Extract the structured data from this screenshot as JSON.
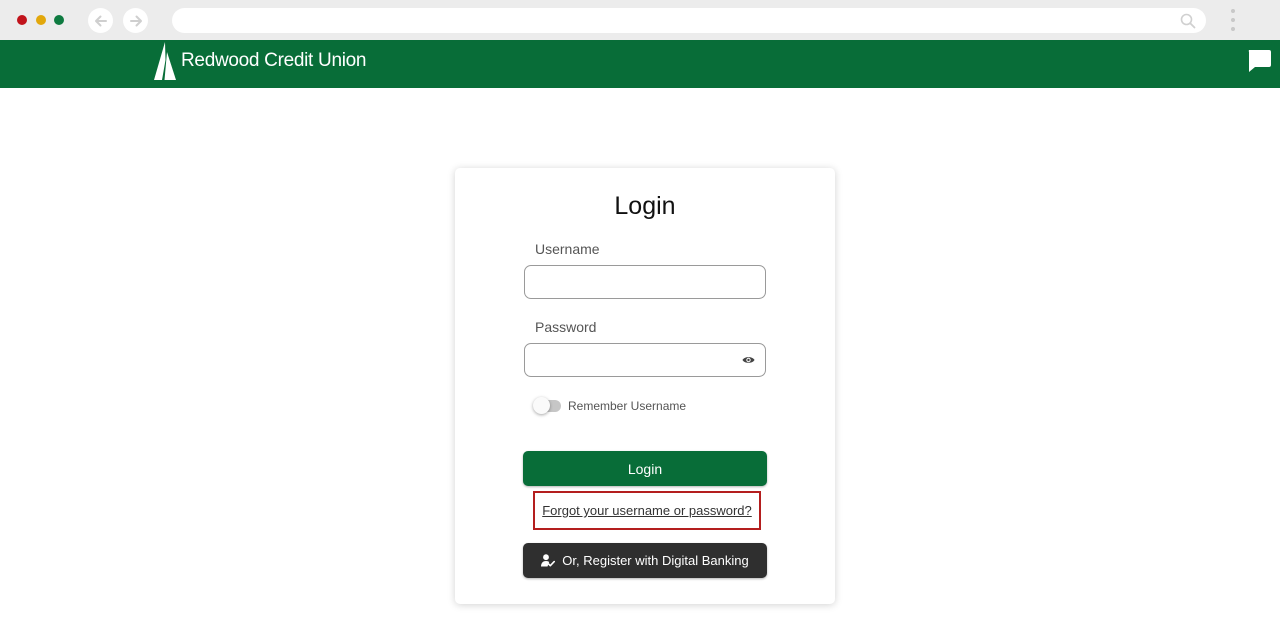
{
  "colors": {
    "brand_green": "#086d38",
    "dark_button": "#2f2f2f",
    "highlight_red": "#b41e1e",
    "traffic_red": "#c1131b",
    "traffic_yellow": "#e2a70b",
    "traffic_green": "#0e7a40"
  },
  "browser": {
    "back_icon": "arrow-left-icon",
    "forward_icon": "arrow-right-icon",
    "search_icon": "search-icon",
    "menu_icon": "kebab-menu-icon"
  },
  "header": {
    "logo_text": "Redwood Credit Union",
    "logo_icon": "redwood-tree-icon",
    "chat_icon": "chat-bubble-icon"
  },
  "login": {
    "title": "Login",
    "username_label": "Username",
    "username_value": "",
    "password_label": "Password",
    "password_value": "",
    "password_toggle_icon": "eye-icon",
    "remember_label": "Remember Username",
    "remember_checked": false,
    "login_button": "Login",
    "forgot_link": "Forgot your username or password?",
    "register_button": "Or, Register with Digital Banking",
    "register_icon": "user-check-icon"
  }
}
